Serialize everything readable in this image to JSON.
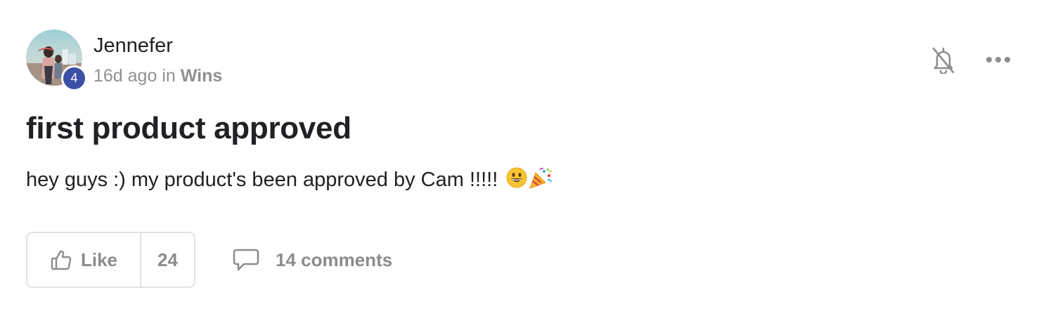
{
  "post": {
    "author": {
      "name": "Jennefer",
      "level": "4",
      "avatar_icon": "user-photo"
    },
    "meta": {
      "time": "16d ago",
      "in_word": "in",
      "category": "Wins"
    },
    "title": "first product approved",
    "body": "hey guys :) my product's been approved by Cam !!!!!",
    "body_emojis": [
      "grinning-face-icon",
      "party-popper-icon"
    ],
    "actions": {
      "like_label": "Like",
      "like_count": "24",
      "comments_label": "14 comments"
    },
    "header_icons": [
      "bell-off-icon",
      "more-icon"
    ]
  },
  "colors": {
    "badge": "#3c4fa6",
    "text_primary": "#202124",
    "text_muted": "#8c8c8c",
    "border": "#e3e3e3"
  }
}
